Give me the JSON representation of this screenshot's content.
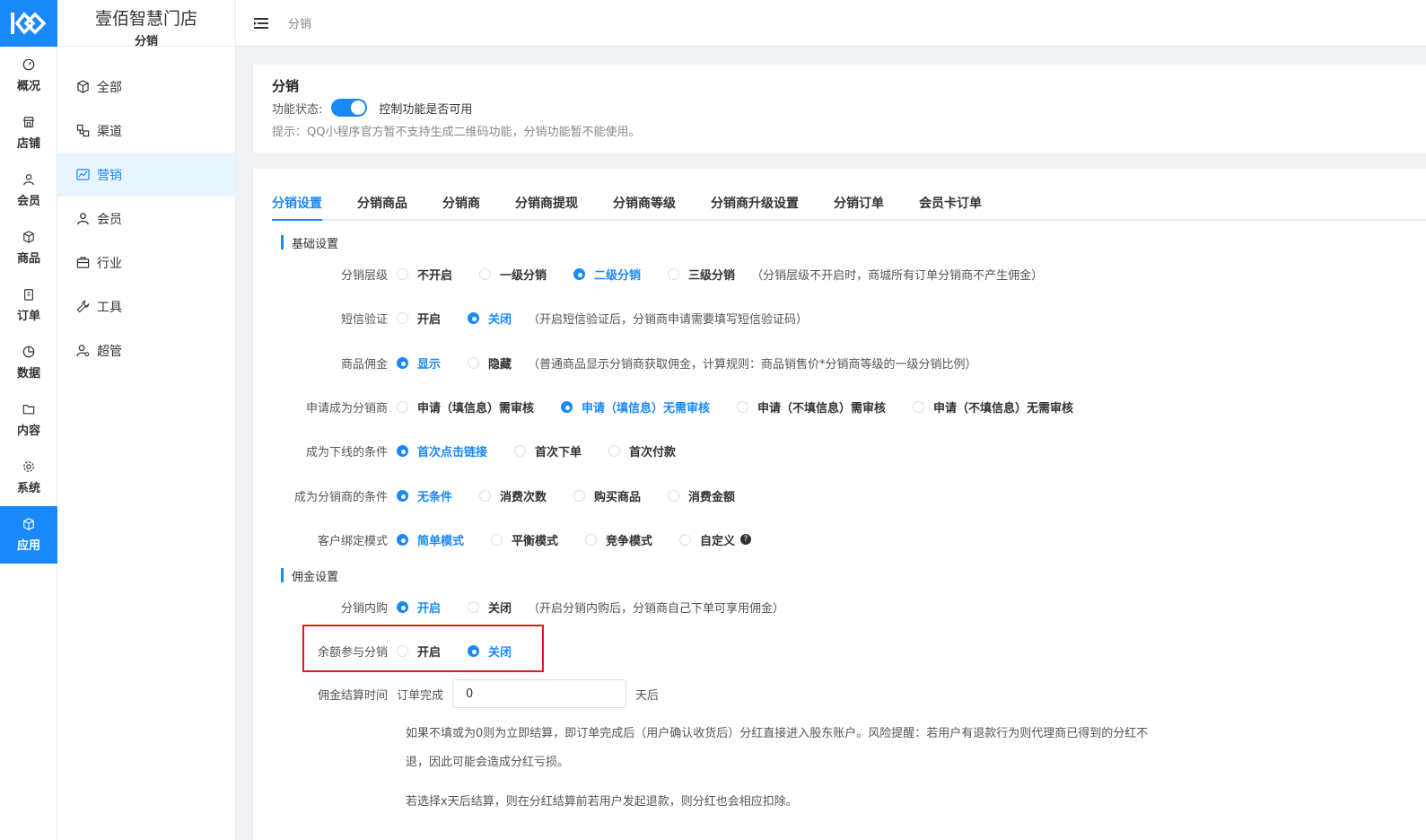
{
  "rail": {
    "items": [
      {
        "label": "概况",
        "icon": "dashboard-icon"
      },
      {
        "label": "店铺",
        "icon": "shop-icon"
      },
      {
        "label": "会员",
        "icon": "user-icon"
      },
      {
        "label": "商品",
        "icon": "box-icon"
      },
      {
        "label": "订单",
        "icon": "clipboard-icon"
      },
      {
        "label": "数据",
        "icon": "pie-icon"
      },
      {
        "label": "内容",
        "icon": "folder-icon"
      },
      {
        "label": "系统",
        "icon": "gear-icon"
      },
      {
        "label": "应用",
        "icon": "cube-icon",
        "active": true
      }
    ]
  },
  "submenu": {
    "store_name": "壹佰智慧门店",
    "section": "分销",
    "items": [
      {
        "label": "全部",
        "icon": "cube-icon"
      },
      {
        "label": "渠道",
        "icon": "channel-icon"
      },
      {
        "label": "营销",
        "icon": "chart-icon",
        "active": true
      },
      {
        "label": "会员",
        "icon": "user-icon"
      },
      {
        "label": "行业",
        "icon": "briefcase-icon"
      },
      {
        "label": "工具",
        "icon": "wrench-icon"
      },
      {
        "label": "超管",
        "icon": "admin-icon"
      }
    ]
  },
  "topbar": {
    "breadcrumb": "分销"
  },
  "feature": {
    "title": "分销",
    "status_label": "功能状态:",
    "status_on": true,
    "status_desc": "控制功能是否可用",
    "hint": "提示：QQ小程序官方暂不支持生成二维码功能，分销功能暂不能使用。"
  },
  "tabs": [
    "分销设置",
    "分销商品",
    "分销商",
    "分销商提现",
    "分销商等级",
    "分销商升级设置",
    "分销订单",
    "会员卡订单"
  ],
  "sections": {
    "basic": "基础设置",
    "commission": "佣金设置"
  },
  "rows": {
    "level": {
      "label": "分销层级",
      "options": [
        "不开启",
        "一级分销",
        "二级分销",
        "三级分销"
      ],
      "selected": 2,
      "note": "（分销层级不开启时，商城所有订单分销商不产生佣金）"
    },
    "sms": {
      "label": "短信验证",
      "options": [
        "开启",
        "关闭"
      ],
      "selected": 1,
      "note": "（开启短信验证后，分销商申请需要填写短信验证码）"
    },
    "goods_commission": {
      "label": "商品佣金",
      "options": [
        "显示",
        "隐藏"
      ],
      "selected": 0,
      "note": "（普通商品显示分销商获取佣金，计算规则：商品销售价*分销商等级的一级分销比例）"
    },
    "apply": {
      "label": "申请成为分销商",
      "options": [
        "申请（填信息）需审核",
        "申请（填信息）无需审核",
        "申请（不填信息）需审核",
        "申请（不填信息）无需审核"
      ],
      "selected": 1
    },
    "downline": {
      "label": "成为下线的条件",
      "options": [
        "首次点击链接",
        "首次下单",
        "首次付款"
      ],
      "selected": 0
    },
    "become": {
      "label": "成为分销商的条件",
      "options": [
        "无条件",
        "消费次数",
        "购买商品",
        "消费金额"
      ],
      "selected": 0
    },
    "bind": {
      "label": "客户绑定模式",
      "options": [
        "简单模式",
        "平衡模式",
        "竞争模式",
        "自定义"
      ],
      "selected": 0
    },
    "self_buy": {
      "label": "分销内购",
      "options": [
        "开启",
        "关闭"
      ],
      "selected": 0,
      "note": "（开启分销内购后，分销商自己下单可享用佣金）"
    },
    "balance": {
      "label": "余额参与分销",
      "options": [
        "开启",
        "关闭"
      ],
      "selected": 1
    },
    "settle": {
      "label": "佣金结算时间",
      "prefix": "订单完成",
      "value": "0",
      "suffix": "天后"
    }
  },
  "paragraphs": {
    "p1_line1": "如果不填或为0则为立即结算，即订单完成后（用户确认收货后）分红直接进入股东账户。风险提醒：若用户有退款行为则代理商已得到的分红不",
    "p1_line2": "退，因此可能会造成分红亏损。",
    "p2": "若选择x天后结算，则在分红结算前若用户发起退款，则分红也会相应扣除。"
  },
  "colors": {
    "accent": "#1989fa",
    "highlight": "#e0191e"
  }
}
